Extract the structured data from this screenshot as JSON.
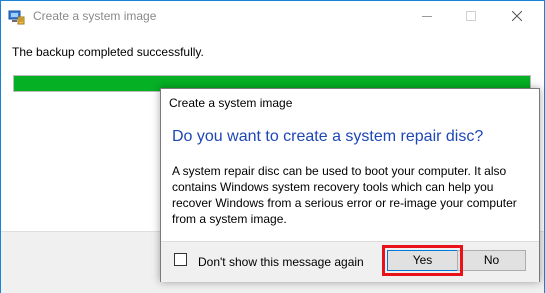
{
  "window": {
    "title": "Create a system image",
    "buttons": {
      "minimize": "minimize-icon",
      "maximize": "maximize-icon",
      "close": "close-icon"
    }
  },
  "main": {
    "message": "The backup completed successfully.",
    "progress_fraction": 1.0,
    "progress_color": "#06b025"
  },
  "dialog": {
    "title": "Create a system image",
    "heading": "Do you want to create a system repair disc?",
    "body": "A system repair disc can be used to boot your computer. It also contains Windows system recovery tools which can help you recover Windows from a serious error or re-image your computer from a system image.",
    "checkbox_label": "Don't show this message again",
    "checkbox_checked": false,
    "yes_label": "Yes",
    "no_label": "No",
    "heading_color": "#1e47b6",
    "highlight_color": "#e8121a"
  }
}
